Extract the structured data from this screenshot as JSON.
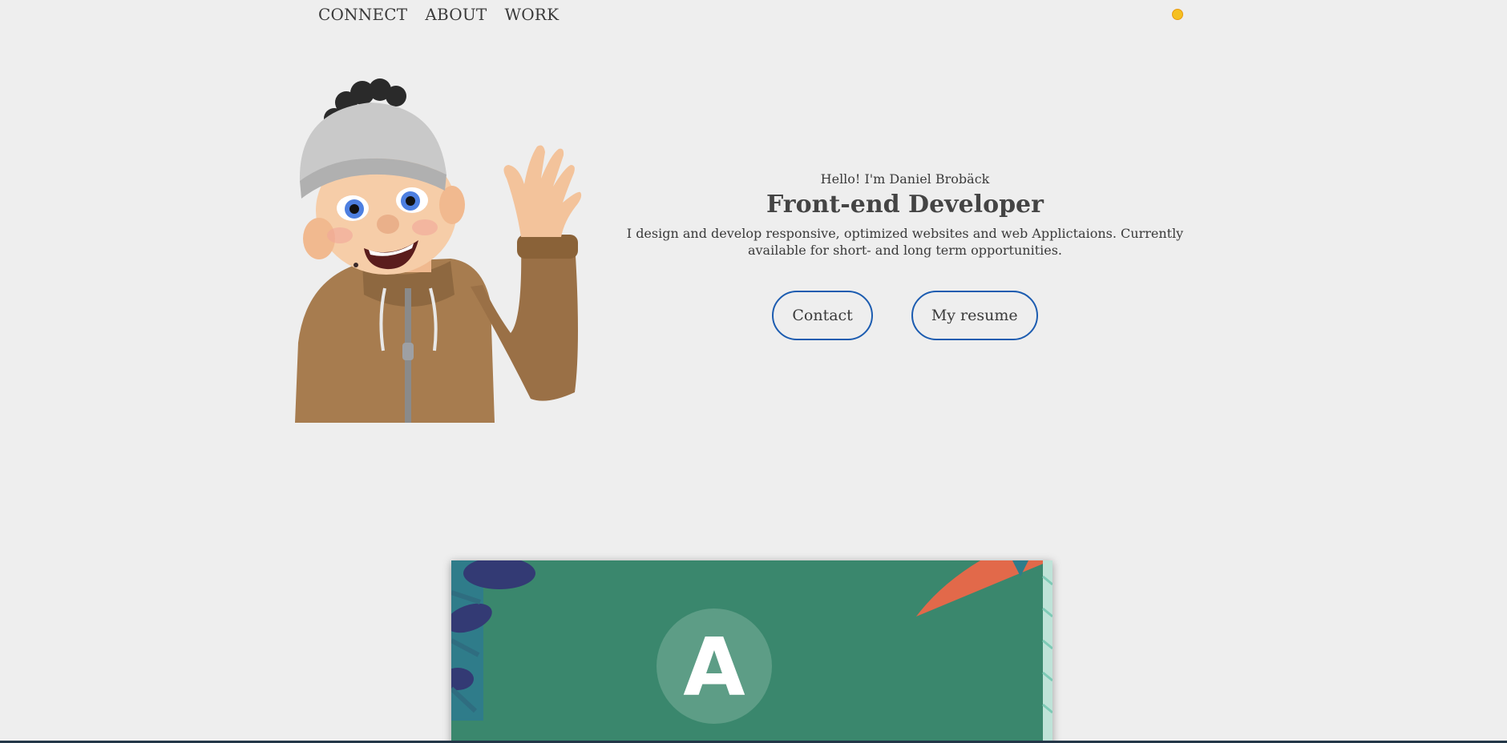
{
  "nav": {
    "items": [
      "CONNECT",
      "ABOUT",
      "WORK"
    ],
    "theme_icon": "sun-icon",
    "theme_color": "#f5c021"
  },
  "hero": {
    "greeting": "Hello! I'm Daniel Brobäck",
    "title": "Front-end Developer",
    "description": "I design and develop responsive, optimized websites and web Applictaions. Currently available for short- and long term opportunities.",
    "buttons": {
      "contact": "Contact",
      "resume": "My resume"
    },
    "button_border_color": "#1c5cb0"
  },
  "work": {
    "card_background": "#3a876d",
    "logo_letter": "A"
  }
}
